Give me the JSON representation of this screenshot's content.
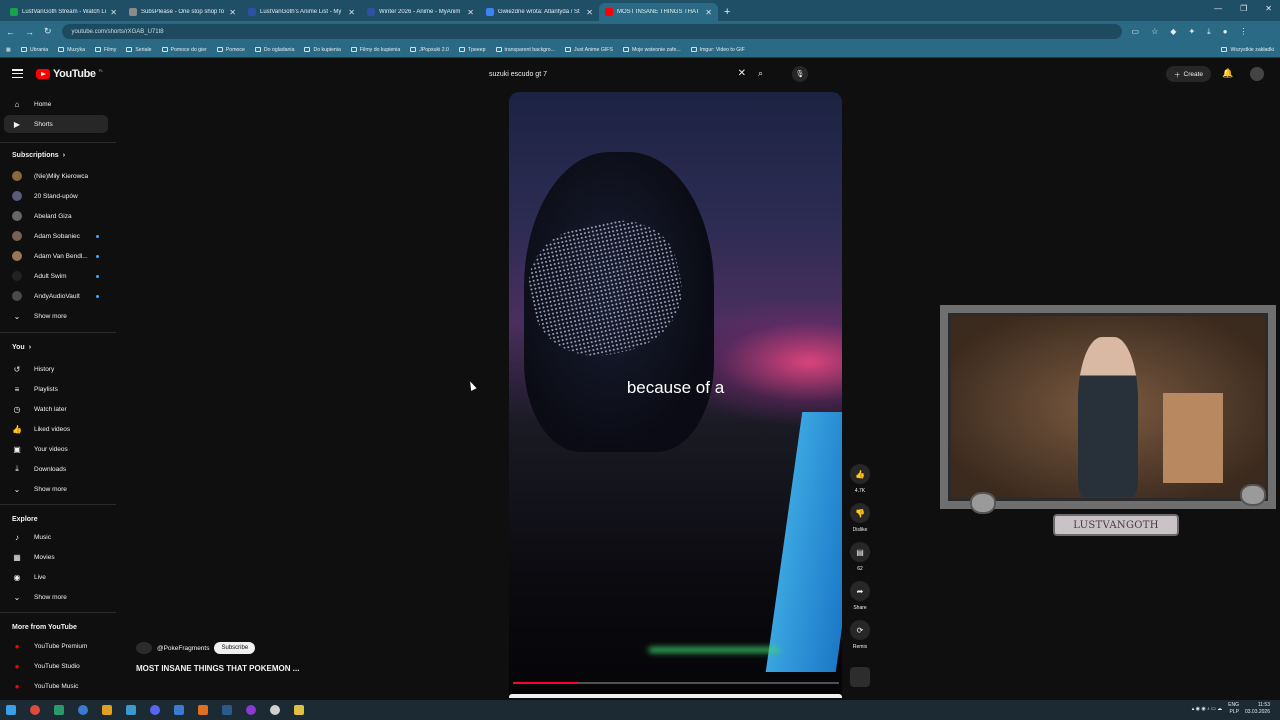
{
  "browser": {
    "tabs": [
      {
        "title": "LustVanGoth Stream - Watch Li",
        "color": "#16a34a"
      },
      {
        "title": "SubsPlease - One stop shop fo",
        "color": "#8b8b8b"
      },
      {
        "title": "LustVanGoth's Anime List - My",
        "color": "#2e51a2"
      },
      {
        "title": "Winter 2026 - Anime - MyAnim",
        "color": "#2e51a2"
      },
      {
        "title": "Gwiezdne wrota: Atlantyda / St",
        "color": "#3b82f6"
      },
      {
        "title": "MOST INSANE THINGS THAT",
        "color": "#ff0000"
      }
    ],
    "address": "youtube.com/shorts/rXGAB_U71t8",
    "bookmarks": [
      "Ubrania",
      "Muzyka",
      "Filmy",
      "Seriale",
      "Pomoce do gier",
      "Pomoce",
      "Do ogladania",
      "Do kupienia",
      "Filmy do kupienia",
      "JPopsuki 2.0",
      "Tpeeep",
      "transparent backgro...",
      "Just Anime GIFS",
      "Moje wsteonie zafe...",
      "Imgur: Video to GIF"
    ],
    "all_bookmarks": "Wszystkie zakładki"
  },
  "youtube": {
    "logo": "YouTube",
    "country": "PL",
    "search_value": "suzuki escudo gt 7",
    "create_label": "Create"
  },
  "sidebar": {
    "main": [
      {
        "label": "Home",
        "icon": "home-icon",
        "glyph": "⌂"
      },
      {
        "label": "Shorts",
        "icon": "shorts-icon",
        "glyph": "▶"
      }
    ],
    "subscriptions_title": "Subscriptions",
    "subscriptions": [
      {
        "label": "(Nie)Miły Kierowca",
        "color": "#8a6a3a",
        "dot": false
      },
      {
        "label": "20 Stand-upów",
        "color": "#5a5a7a",
        "dot": false
      },
      {
        "label": "Abelard Giza",
        "color": "#666666",
        "dot": false
      },
      {
        "label": "Adam Sobaniec",
        "color": "#7a6050",
        "dot": true
      },
      {
        "label": "Adam Van Bendl...",
        "color": "#997755",
        "dot": true
      },
      {
        "label": "Adult Swim",
        "color": "#222222",
        "dot": true
      },
      {
        "label": "AndyAudioVault",
        "color": "#4a4a4a",
        "dot": true
      }
    ],
    "show_more": "Show more",
    "you_title": "You",
    "you": [
      {
        "label": "History",
        "glyph": "↺"
      },
      {
        "label": "Playlists",
        "glyph": "≡"
      },
      {
        "label": "Watch later",
        "glyph": "◷"
      },
      {
        "label": "Liked videos",
        "glyph": "👍"
      },
      {
        "label": "Your videos",
        "glyph": "▣"
      },
      {
        "label": "Downloads",
        "glyph": "⤓"
      }
    ],
    "explore_title": "Explore",
    "explore": [
      {
        "label": "Music",
        "glyph": "♪"
      },
      {
        "label": "Movies",
        "glyph": "▦"
      },
      {
        "label": "Live",
        "glyph": "◉"
      }
    ],
    "more_title": "More from YouTube",
    "more": [
      {
        "label": "YouTube Premium"
      },
      {
        "label": "YouTube Studio"
      },
      {
        "label": "YouTube Music"
      }
    ]
  },
  "short": {
    "caption": "because of a",
    "channel": "@PokeFragments",
    "subscribe_label": "Subscribe",
    "title": "MOST INSANE THINGS THAT POKEMON ...",
    "progress": 0.2
  },
  "actions": [
    {
      "name": "like",
      "label": "4.7K",
      "glyph": "👍"
    },
    {
      "name": "dislike",
      "label": "Dislike",
      "glyph": "👎"
    },
    {
      "name": "comments",
      "label": "62",
      "glyph": "▤"
    },
    {
      "name": "share",
      "label": "Share",
      "glyph": "➦"
    },
    {
      "name": "remix",
      "label": "Remix",
      "glyph": "⟳"
    }
  ],
  "overlay": {
    "label": "LUSTVANGOTH"
  },
  "taskbar": {
    "lang": "ENG",
    "layout": "PLP",
    "time": "11:53",
    "date": "03.03.2026"
  }
}
